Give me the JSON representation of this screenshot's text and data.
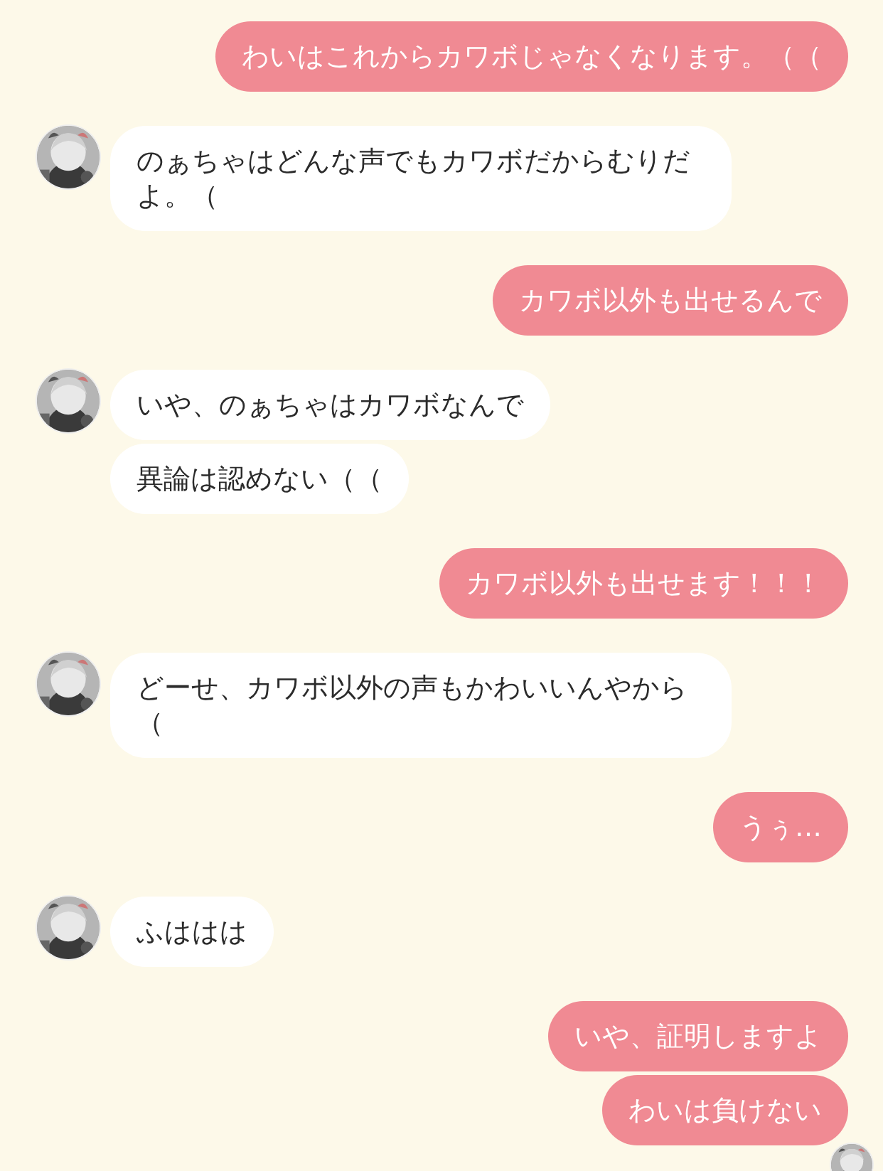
{
  "chat": [
    {
      "kind": "sent",
      "messages": [
        "わいはこれからカワボじゃなくなります。（（"
      ]
    },
    {
      "kind": "received",
      "messages": [
        "のぁちゃはどんな声でもカワボだからむりだよ。（"
      ]
    },
    {
      "kind": "sent",
      "messages": [
        "カワボ以外も出せるんで"
      ]
    },
    {
      "kind": "received",
      "messages": [
        "いや、のぁちゃはカワボなんで",
        "異論は認めない（（"
      ]
    },
    {
      "kind": "sent",
      "messages": [
        "カワボ以外も出せます！！！"
      ]
    },
    {
      "kind": "received",
      "messages": [
        "どーせ、カワボ以外の声もかわいいんやから（"
      ]
    },
    {
      "kind": "sent",
      "messages": [
        "うぅ…"
      ]
    },
    {
      "kind": "received",
      "messages": [
        "ふははは"
      ]
    },
    {
      "kind": "sent",
      "messages": [
        "いや、証明しますよ",
        "わいは負けない"
      ],
      "read_avatar": true
    }
  ]
}
